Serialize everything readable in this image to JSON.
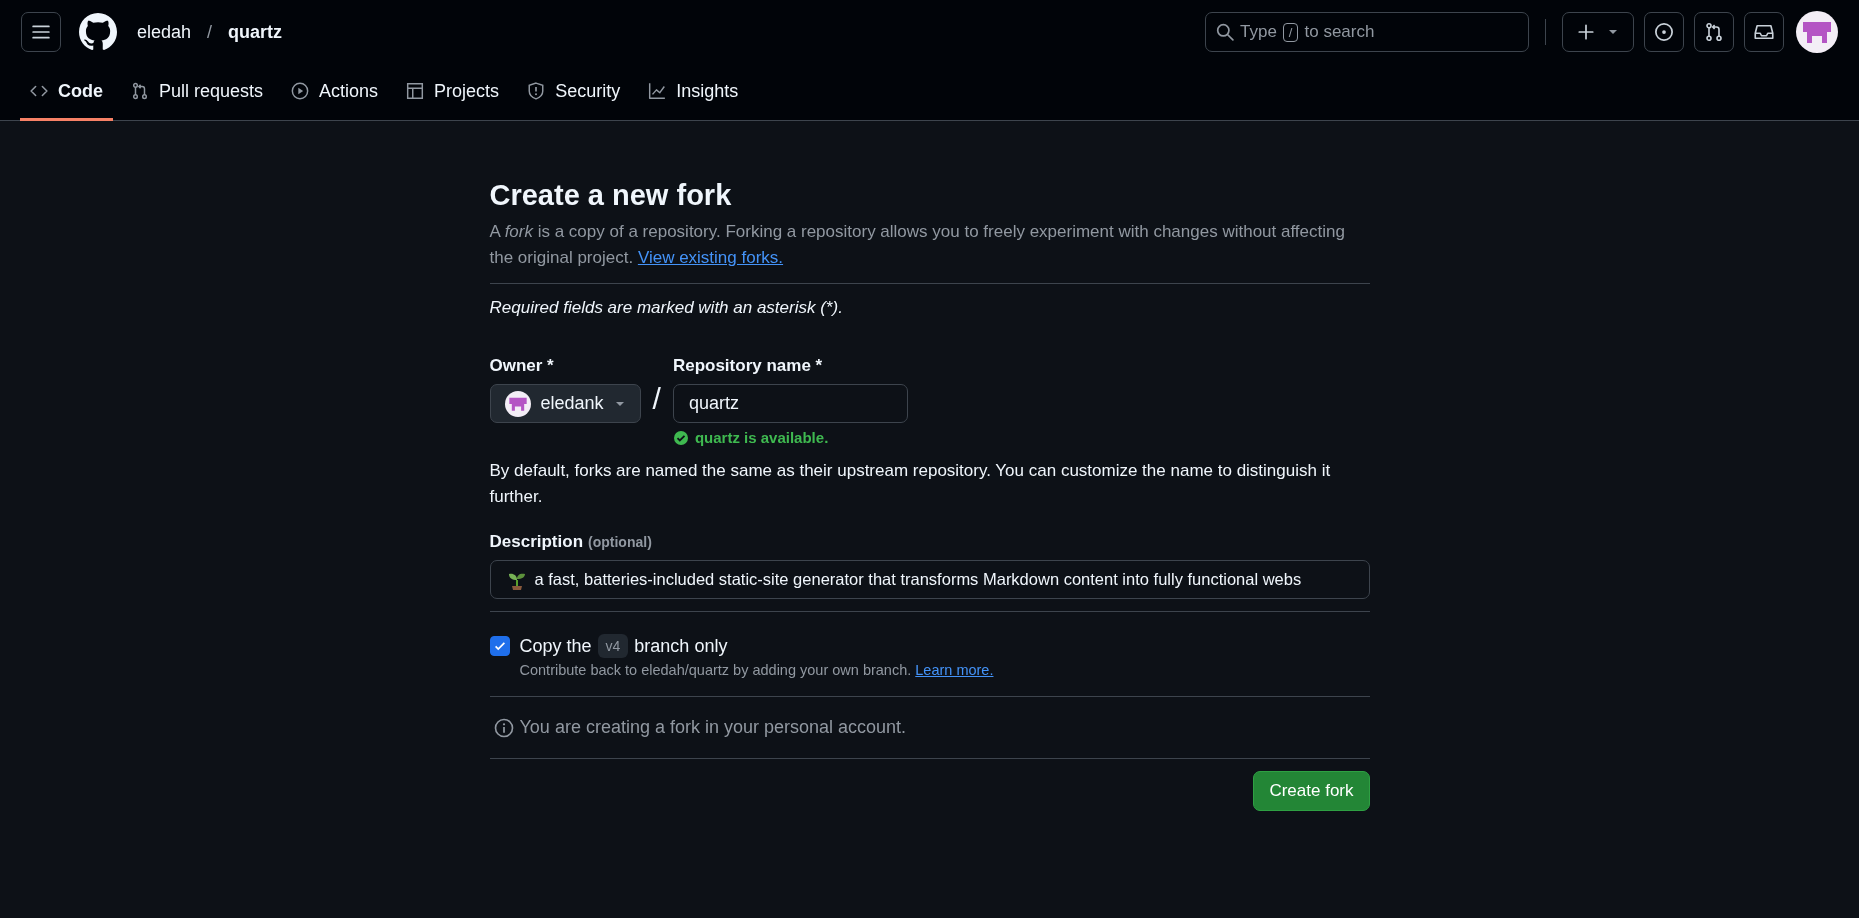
{
  "header": {
    "owner": "eledah",
    "separator": "/",
    "repo": "quartz",
    "search": {
      "hint_start": "Type",
      "key": "/",
      "hint_end": "to search"
    }
  },
  "tabs": [
    {
      "label": "Code",
      "kind": "code",
      "selected": true
    },
    {
      "label": "Pull requests",
      "kind": "pulls",
      "selected": false
    },
    {
      "label": "Actions",
      "kind": "actions",
      "selected": false
    },
    {
      "label": "Projects",
      "kind": "projects",
      "selected": false
    },
    {
      "label": "Security",
      "kind": "security",
      "selected": false
    },
    {
      "label": "Insights",
      "kind": "insights",
      "selected": false
    }
  ],
  "form": {
    "title": "Create a new fork",
    "intro": "A *fork* is a copy of a repository. Forking a repository allows you to freely experiment with changes without affecting the original project.",
    "intro_link": "View existing forks.",
    "required_note": "Required fields are marked with an asterisk (*).",
    "owner_label": "Owner *",
    "owner_value": "eledank",
    "slash": "/",
    "repo_label": "Repository name *",
    "repo_value": "quartz",
    "availability": "quartz is available.",
    "available": true,
    "naming_note": "By default, forks are named the same as their upstream repository. You can customize the name to distinguish it further.",
    "description_label": "Description",
    "description_hint": "(optional)",
    "description_value": "a fast, batteries-included static-site generator that transforms Markdown content into fully functional webs",
    "copy_branch": {
      "checked": true,
      "before": "Copy the",
      "branch": "v4",
      "after": "branch only",
      "note": "Contribute back to eledah/quartz by adding your own branch.",
      "link": "Learn more."
    },
    "account_note": "You are creating a fork in your personal account.",
    "submit": "Create fork"
  }
}
